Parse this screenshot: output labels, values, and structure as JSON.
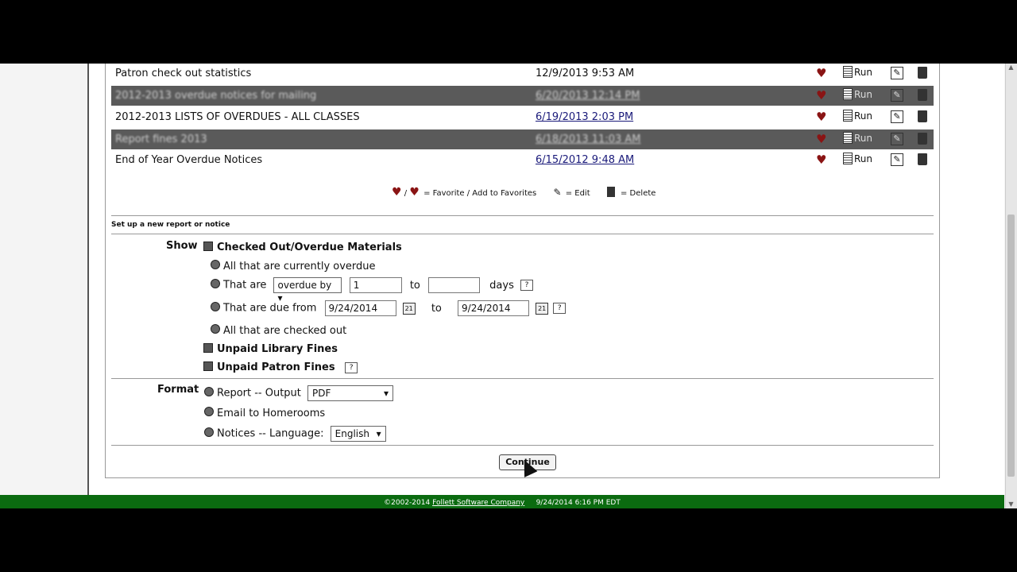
{
  "reports": [
    {
      "name": "Patron check out statistics",
      "date": "12/9/2013 9:53 AM",
      "linked": false,
      "blurred": false
    },
    {
      "name": "2012-2013 overdue notices for mailing",
      "date": "6/20/2013 12:14 PM",
      "linked": true,
      "blurred": true
    },
    {
      "name": "2012-2013 LISTS OF OVERDUES - ALL CLASSES",
      "date": "6/19/2013 2:03 PM",
      "linked": true,
      "blurred": false
    },
    {
      "name": "Report fines 2013",
      "date": "6/18/2013 11:03 AM",
      "linked": true,
      "blurred": true
    },
    {
      "name": "End of Year Overdue Notices",
      "date": "6/15/2012 9:48 AM",
      "linked": true,
      "blurred": false
    }
  ],
  "actions": {
    "run": "Run"
  },
  "legend": {
    "favorite": "/ ",
    "favorite_text": "= Favorite / Add to Favorites",
    "edit_text": "= Edit",
    "delete_text": "= Delete"
  },
  "setup_title": "Set up a new report or notice",
  "show": {
    "label": "Show",
    "checked_out": "Checked Out/Overdue Materials",
    "all_overdue": "All that are currently overdue",
    "that_are": "That are",
    "overdue_select": "overdue by",
    "from_value": "1",
    "to_label": "to",
    "to_value": "",
    "days_label": "days",
    "due_from": "That are due from",
    "due_from_value": "9/24/2014",
    "due_to_label": "to",
    "due_to_value": "9/24/2014",
    "all_checked_out": "All that are checked out",
    "library_fines": "Unpaid Library Fines",
    "patron_fines": "Unpaid Patron Fines",
    "help": "?"
  },
  "format": {
    "label": "Format",
    "report_output": "Report -- Output",
    "output_value": "PDF",
    "email": "Email to Homerooms",
    "notices_language": "Notices -- Language:",
    "language_value": "English"
  },
  "continue_label": "Continue",
  "footer": {
    "copyright": "©2002-2014",
    "company": "Follett Software Company",
    "timestamp": "9/24/2014 6:16 PM EDT"
  }
}
